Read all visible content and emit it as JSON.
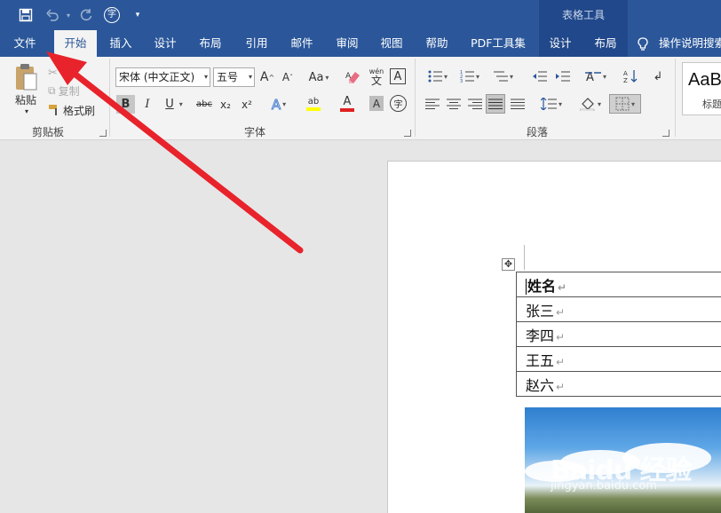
{
  "quick_access": {
    "save_icon": "save-icon",
    "undo_icon": "undo-icon",
    "redo_icon": "redo-icon",
    "font_icon": "字",
    "customize_icon": "customize-dropdown-icon"
  },
  "contextual": {
    "title": "表格工具"
  },
  "tabs": [
    "文件",
    "开始",
    "插入",
    "设计",
    "布局",
    "引用",
    "邮件",
    "审阅",
    "视图",
    "帮助",
    "PDF工具集",
    "设计",
    "布局"
  ],
  "active_tab": "开始",
  "tell_me": {
    "label": "操作说明搜索"
  },
  "ribbon": {
    "clipboard": {
      "paste_label": "粘贴",
      "cut_label": "剪切",
      "copy_label": "复制",
      "format_painter_label": "格式刷",
      "group_label": "剪贴板"
    },
    "font": {
      "font_name": "宋体 (中文正文)",
      "font_size": "五号",
      "group_label": "字体",
      "grow_label": "A",
      "shrink_label": "A",
      "case_label": "Aa",
      "phonetic_label": "wén",
      "border_char_label": "A",
      "bold_label": "B",
      "italic_label": "I",
      "underline_label": "U",
      "strike_label": "abc",
      "sub_label": "x₂",
      "sup_label": "x²",
      "effects_label": "A",
      "highlight_label": "ab",
      "font_color_label": "A",
      "shading_label": "A",
      "enclose_label": "字"
    },
    "paragraph": {
      "group_label": "段落"
    },
    "styles": {
      "preview_text": "AaB",
      "style_name": "标题"
    }
  },
  "document": {
    "table_rows": [
      "姓名",
      "张三",
      "李四",
      "王五",
      "赵六"
    ],
    "paragraph_mark": "↵",
    "move_handle": "✥"
  },
  "image": {
    "watermark": "Baidu 经验",
    "watermark_sub": "jingyan.baidu.com"
  },
  "colors": {
    "titlebar": "#2b579a",
    "ribbon": "#f3f3f3",
    "arrow": "#e8232b",
    "highlight_yellow": "#ffff00",
    "font_red": "#e02020"
  }
}
